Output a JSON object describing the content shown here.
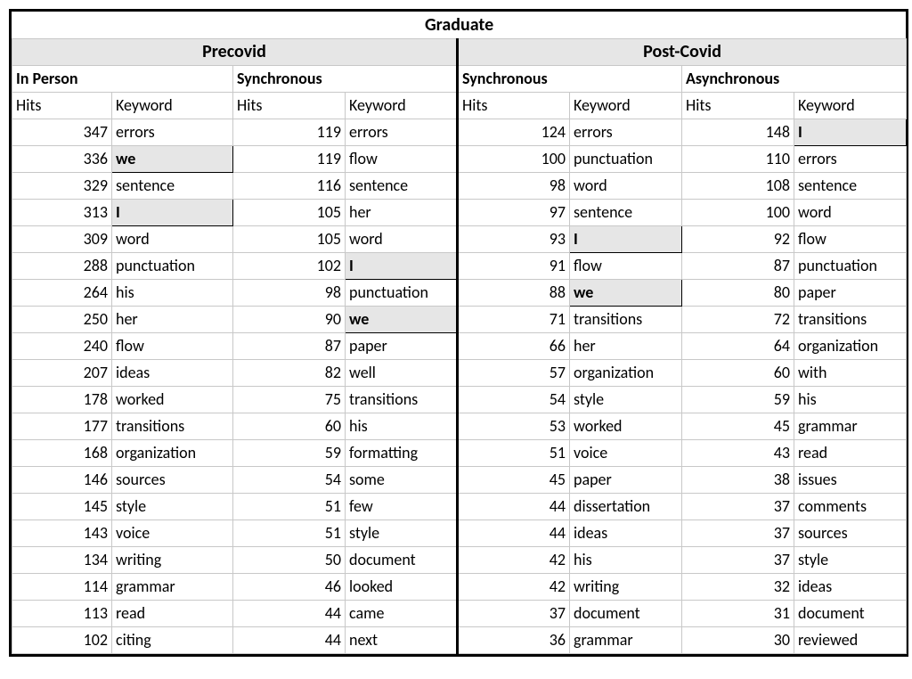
{
  "title": "Graduate",
  "periods": {
    "pre": "Precovid",
    "post": "Post-Covid"
  },
  "categories": {
    "inperson": "In Person",
    "sync": "Synchronous",
    "async": "Asynchronous"
  },
  "colheaders": {
    "hits": "Hits",
    "keyword": "Keyword"
  },
  "cols": {
    "pre_inperson": [
      {
        "hits": 347,
        "kw": "errors",
        "hl": false
      },
      {
        "hits": 336,
        "kw": "we",
        "hl": true
      },
      {
        "hits": 329,
        "kw": "sentence",
        "hl": false
      },
      {
        "hits": 313,
        "kw": "I",
        "hl": true
      },
      {
        "hits": 309,
        "kw": "word",
        "hl": false
      },
      {
        "hits": 288,
        "kw": "punctuation",
        "hl": false
      },
      {
        "hits": 264,
        "kw": "his",
        "hl": false
      },
      {
        "hits": 250,
        "kw": "her",
        "hl": false
      },
      {
        "hits": 240,
        "kw": "flow",
        "hl": false
      },
      {
        "hits": 207,
        "kw": "ideas",
        "hl": false
      },
      {
        "hits": 178,
        "kw": "worked",
        "hl": false
      },
      {
        "hits": 177,
        "kw": "transitions",
        "hl": false
      },
      {
        "hits": 168,
        "kw": "organization",
        "hl": false
      },
      {
        "hits": 146,
        "kw": "sources",
        "hl": false
      },
      {
        "hits": 145,
        "kw": "style",
        "hl": false
      },
      {
        "hits": 143,
        "kw": "voice",
        "hl": false
      },
      {
        "hits": 134,
        "kw": "writing",
        "hl": false
      },
      {
        "hits": 114,
        "kw": "grammar",
        "hl": false
      },
      {
        "hits": 113,
        "kw": "read",
        "hl": false
      },
      {
        "hits": 102,
        "kw": "citing",
        "hl": false
      }
    ],
    "pre_sync": [
      {
        "hits": 119,
        "kw": "errors",
        "hl": false
      },
      {
        "hits": 119,
        "kw": "flow",
        "hl": false
      },
      {
        "hits": 116,
        "kw": "sentence",
        "hl": false
      },
      {
        "hits": 105,
        "kw": "her",
        "hl": false
      },
      {
        "hits": 105,
        "kw": "word",
        "hl": false
      },
      {
        "hits": 102,
        "kw": "I",
        "hl": true
      },
      {
        "hits": 98,
        "kw": "punctuation",
        "hl": false
      },
      {
        "hits": 90,
        "kw": "we",
        "hl": true
      },
      {
        "hits": 87,
        "kw": "paper",
        "hl": false
      },
      {
        "hits": 82,
        "kw": "well",
        "hl": false
      },
      {
        "hits": 75,
        "kw": "transitions",
        "hl": false
      },
      {
        "hits": 60,
        "kw": "his",
        "hl": false
      },
      {
        "hits": 59,
        "kw": "formatting",
        "hl": false
      },
      {
        "hits": 54,
        "kw": "some",
        "hl": false
      },
      {
        "hits": 51,
        "kw": "few",
        "hl": false
      },
      {
        "hits": 51,
        "kw": "style",
        "hl": false
      },
      {
        "hits": 50,
        "kw": "document",
        "hl": false
      },
      {
        "hits": 46,
        "kw": "looked",
        "hl": false
      },
      {
        "hits": 44,
        "kw": "came",
        "hl": false
      },
      {
        "hits": 44,
        "kw": "next",
        "hl": false
      }
    ],
    "post_sync": [
      {
        "hits": 124,
        "kw": "errors",
        "hl": false
      },
      {
        "hits": 100,
        "kw": "punctuation",
        "hl": false
      },
      {
        "hits": 98,
        "kw": "word",
        "hl": false
      },
      {
        "hits": 97,
        "kw": "sentence",
        "hl": false
      },
      {
        "hits": 93,
        "kw": "I",
        "hl": true
      },
      {
        "hits": 91,
        "kw": "flow",
        "hl": false
      },
      {
        "hits": 88,
        "kw": "we",
        "hl": true
      },
      {
        "hits": 71,
        "kw": "transitions",
        "hl": false
      },
      {
        "hits": 66,
        "kw": "her",
        "hl": false
      },
      {
        "hits": 57,
        "kw": "organization",
        "hl": false
      },
      {
        "hits": 54,
        "kw": "style",
        "hl": false
      },
      {
        "hits": 53,
        "kw": "worked",
        "hl": false
      },
      {
        "hits": 51,
        "kw": "voice",
        "hl": false
      },
      {
        "hits": 45,
        "kw": "paper",
        "hl": false
      },
      {
        "hits": 44,
        "kw": "dissertation",
        "hl": false
      },
      {
        "hits": 44,
        "kw": "ideas",
        "hl": false
      },
      {
        "hits": 42,
        "kw": "his",
        "hl": false
      },
      {
        "hits": 42,
        "kw": "writing",
        "hl": false
      },
      {
        "hits": 37,
        "kw": "document",
        "hl": false
      },
      {
        "hits": 36,
        "kw": "grammar",
        "hl": false
      }
    ],
    "post_async": [
      {
        "hits": 148,
        "kw": "I",
        "hl": true
      },
      {
        "hits": 110,
        "kw": "errors",
        "hl": false
      },
      {
        "hits": 108,
        "kw": "sentence",
        "hl": false
      },
      {
        "hits": 100,
        "kw": "word",
        "hl": false
      },
      {
        "hits": 92,
        "kw": "flow",
        "hl": false
      },
      {
        "hits": 87,
        "kw": "punctuation",
        "hl": false
      },
      {
        "hits": 80,
        "kw": "paper",
        "hl": false
      },
      {
        "hits": 72,
        "kw": "transitions",
        "hl": false
      },
      {
        "hits": 64,
        "kw": "organization",
        "hl": false
      },
      {
        "hits": 60,
        "kw": "with",
        "hl": false
      },
      {
        "hits": 59,
        "kw": "his",
        "hl": false
      },
      {
        "hits": 45,
        "kw": "grammar",
        "hl": false
      },
      {
        "hits": 43,
        "kw": "read",
        "hl": false
      },
      {
        "hits": 38,
        "kw": "issues",
        "hl": false
      },
      {
        "hits": 37,
        "kw": "comments",
        "hl": false
      },
      {
        "hits": 37,
        "kw": "sources",
        "hl": false
      },
      {
        "hits": 37,
        "kw": "style",
        "hl": false
      },
      {
        "hits": 32,
        "kw": "ideas",
        "hl": false
      },
      {
        "hits": 31,
        "kw": "document",
        "hl": false
      },
      {
        "hits": 30,
        "kw": "reviewed",
        "hl": false
      }
    ]
  }
}
